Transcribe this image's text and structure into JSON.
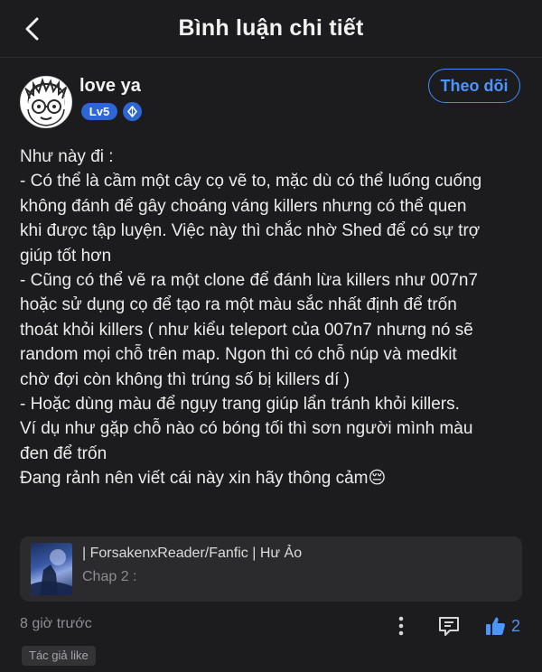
{
  "header": {
    "title": "Bình luận chi tiết"
  },
  "comment": {
    "author": {
      "name": "love ya",
      "level_badge": "Lv5"
    },
    "follow_label": "Theo dõi",
    "body_lines": [
      "Như này đi :",
      "- Có thể là cầm một cây cọ vẽ to, mặc dù có thể luống cuống",
      "không đánh để gây choáng váng killers nhưng có thể quen",
      "khi được tập luyện. Việc này thì chắc nhờ Shed để có sự trợ",
      "giúp tốt hơn",
      "- Cũng có thể vẽ ra một clone để đánh lừa killers như 007n7",
      "hoặc sử dụng cọ để tạo ra một màu sắc nhất định để trốn",
      "thoát khỏi killers ( như kiểu teleport của 007n7 nhưng nó sẽ",
      "random mọi chỗ trên map. Ngon thì có chỗ núp và medkit",
      "chờ đợi còn không thì trúng số bị killers dí )",
      "- Hoặc dùng màu để ngụy trang giúp lẩn tránh khỏi killers.",
      "Ví dụ như gặp chỗ nào có bóng tối thì sơn người mình màu",
      "đen để trốn",
      "Đang rảnh nên viết cái này xin hãy thông cảm😔"
    ],
    "story_card": {
      "title": "| ForsakenxReader/Fanfic | Hư Ảo",
      "subtitle": "Chap 2 :"
    },
    "timestamp": "8 giờ trước",
    "like_count": "2",
    "author_like_tag": "Tác giả like"
  },
  "icons": {
    "back": "chevron-left-icon",
    "more": "more-vertical-icon",
    "reply": "comment-icon",
    "like": "thumbs-up-icon",
    "badge": "diamond-icon"
  },
  "colors": {
    "background": "#1c1c1e",
    "accent": "#4b95ff",
    "badge_blue": "#2f66d6",
    "card": "#2b2b2e"
  }
}
